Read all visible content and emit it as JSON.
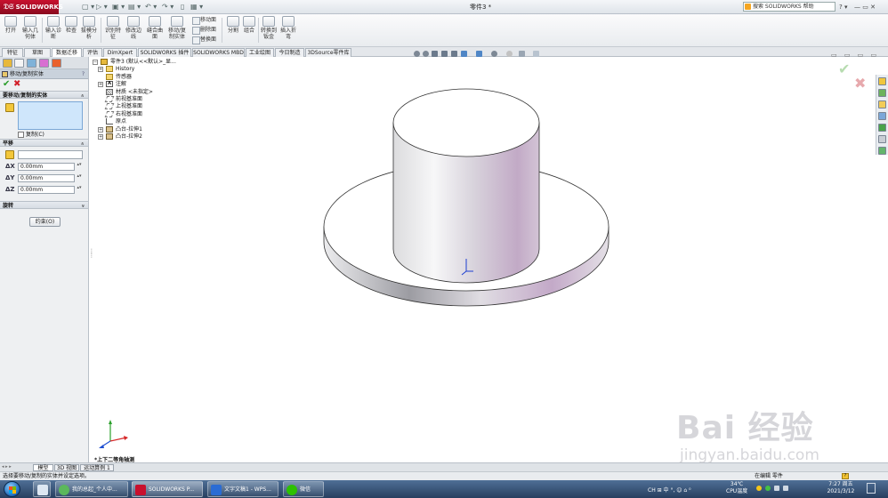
{
  "app": {
    "logo_text": "SOLIDWORKS",
    "window_title": "零件3 *",
    "help_search": "搜索 SOLIDWORKS 帮助",
    "help_btn": "? ▾",
    "window_buttons": "— ▭ ✕"
  },
  "quick_access": {
    "items": [
      "▢ ▾",
      "▷ ▾",
      "▣ ▾",
      "▤ ▾",
      "↶ ▾",
      "↷ ▾",
      "▯",
      "▦ ▾"
    ]
  },
  "command_manager": {
    "buttons": [
      "打开",
      "输入几何体",
      "输入诊断",
      "检查",
      "拔模分析",
      "识别特征",
      "修改边线",
      "缝合曲面",
      "移动/复制实体",
      "分割",
      "组合",
      "转换到钣金",
      "插入折弯"
    ],
    "small_buttons": [
      "移动面",
      "删除面",
      "替换面"
    ]
  },
  "tabs": {
    "items": [
      "特征",
      "草图",
      "数据迁移",
      "评估",
      "DimXpert",
      "SOLIDWORKS 插件",
      "SOLIDWORKS MBD",
      "工业绘图",
      "今日制造",
      "3DSource零件库"
    ],
    "active_index": 2
  },
  "property_manager": {
    "title": "移动/复制实体",
    "help": "?",
    "ok": "✔",
    "cancel": "✖",
    "group_bodies": "要移动/复制的实体",
    "copy_label": "复制(C)",
    "group_translate": "平移",
    "dx_label": "ΔX",
    "dx_value": "0.00mm",
    "dy_label": "ΔY",
    "dy_value": "0.00mm",
    "dz_label": "ΔZ",
    "dz_value": "0.00mm",
    "group_rotate": "旋转",
    "constraint_button": "约束(O)",
    "chevron_up": "»",
    "chevron_down": "»",
    "spin": "▴▾"
  },
  "feature_tree": [
    {
      "label": "零件3 (默认<<默认>_显...",
      "expander": "−",
      "icon": "part"
    },
    {
      "label": "History",
      "expander": "+",
      "icon": "folder"
    },
    {
      "label": "传感器",
      "expander": "",
      "icon": "folder"
    },
    {
      "label": "注解",
      "expander": "+",
      "icon": "annot"
    },
    {
      "label": "材质 <未指定>",
      "expander": "",
      "icon": "material"
    },
    {
      "label": "前视基准面",
      "expander": "",
      "icon": "plane"
    },
    {
      "label": "上视基准面",
      "expander": "",
      "icon": "plane"
    },
    {
      "label": "右视基准面",
      "expander": "",
      "icon": "plane"
    },
    {
      "label": "原点",
      "expander": "",
      "icon": "origin"
    },
    {
      "label": "凸台-拉伸1",
      "expander": "+",
      "icon": "boss"
    },
    {
      "label": "凸台-拉伸2",
      "expander": "+",
      "icon": "boss"
    }
  ],
  "annot_glyph": "A",
  "view": {
    "orientation_label": "*上下二等角轴测",
    "window_controls": "▭ ▭ ▭ ▭",
    "corner_ok": "✔",
    "corner_cancel": "✖"
  },
  "bottom_tabs": {
    "items": [
      "模型",
      "3D 视图",
      "运动算例 1"
    ],
    "active_index": 0,
    "nav": "◂ ▸ ▸"
  },
  "status": {
    "text": "选择要移动/复制的实体并设定选项。",
    "mode": "在编辑 零件",
    "help": "?"
  },
  "taskbar": {
    "items": [
      "我的总起_个人中...",
      "SOLIDWORKS P...",
      "文字文稿1 - WPS...",
      "微信"
    ],
    "tray_ime": "CH  ⊞ 中 °, ☺ ⌂ ⁰",
    "temp": "34℃",
    "cpu": "CPU温度",
    "time": "7:27 周五",
    "date": "2021/3/12"
  },
  "watermark": {
    "brand": "Bai 经验",
    "url": "jingyan.baidu.com"
  },
  "colors": {
    "accent": "#c8102e",
    "cylinder_light": "#f2f2f5",
    "cylinder_shade": "#c4aec8",
    "ok_green": "#2a9d2a",
    "cancel_red": "#d2202a"
  }
}
